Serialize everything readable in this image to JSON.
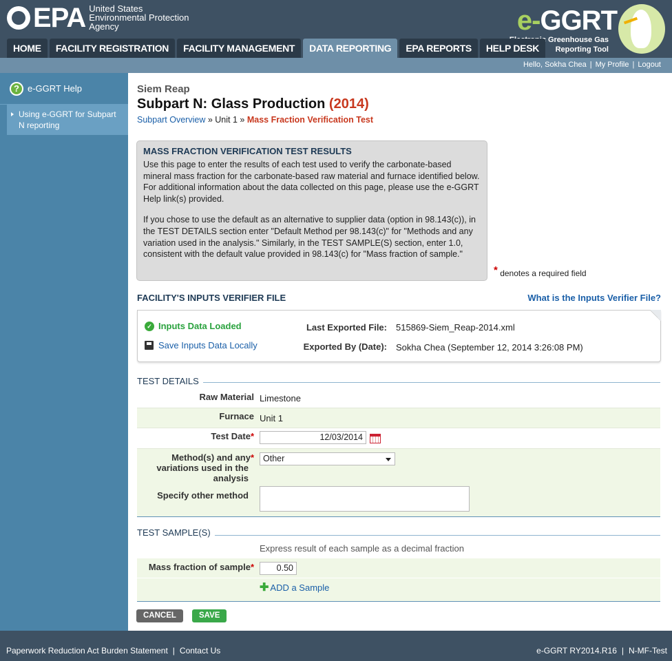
{
  "header": {
    "epa_word": "EPA",
    "epa_agency_lines": [
      "United States",
      "Environmental Protection",
      "Agency"
    ],
    "eggrt_title_e": "e-",
    "eggrt_title_rest": "GGRT",
    "eggrt_sub_lines": [
      "Electronic Greenhouse Gas",
      "Reporting Tool"
    ]
  },
  "nav": {
    "tabs": [
      {
        "label": "HOME",
        "active": false
      },
      {
        "label": "FACILITY REGISTRATION",
        "active": false
      },
      {
        "label": "FACILITY MANAGEMENT",
        "active": false
      },
      {
        "label": "DATA REPORTING",
        "active": true
      },
      {
        "label": "EPA REPORTS",
        "active": false
      },
      {
        "label": "HELP DESK",
        "active": false
      }
    ]
  },
  "userbar": {
    "greeting": "Hello, Sokha Chea",
    "profile": "My Profile",
    "logout": "Logout"
  },
  "sidebar": {
    "help_label": "e-GGRT Help",
    "link_label": "Using e-GGRT for Subpart N reporting"
  },
  "page": {
    "facility": "Siem Reap",
    "title": "Subpart N: Glass Production",
    "year": "(2014)",
    "breadcrumb": {
      "overview": "Subpart Overview",
      "sep": "»",
      "unit": "Unit 1",
      "current": "Mass Fraction Verification Test"
    }
  },
  "infobox": {
    "heading": "MASS FRACTION VERIFICATION TEST RESULTS",
    "para1": "Use this page to enter the results of each test used to verify the carbonate-based mineral mass fraction for the carbonate-based raw material and furnace identified below. For additional information about the data collected on this page, please use the e-GGRT Help link(s) provided.",
    "para2": "If you chose to use the default as an alternative to supplier data (option in 98.143(c)), in the TEST DETAILS section enter \"Default Method per 98.143(c)\" for \"Methods and any variation used in the analysis.\" Similarly, in the TEST SAMPLE(S) section, enter 1.0, consistent with the default value provided in 98.143(c) for \"Mass fraction of sample.\""
  },
  "required_note": {
    "star": "*",
    "text": "denotes a required field"
  },
  "verifier": {
    "section_title": "FACILITY'S INPUTS VERIFIER FILE",
    "help_link": "What is the Inputs Verifier File?",
    "loaded_text": "Inputs Data Loaded",
    "save_text": "Save Inputs Data Locally",
    "last_exported_label": "Last Exported File:",
    "last_exported_value": "515869-Siem_Reap-2014.xml",
    "exported_by_label": "Exported By (Date):",
    "exported_by_value": "Sokha Chea (September 12, 2014 3:26:08 PM)"
  },
  "test_details": {
    "heading": "TEST DETAILS",
    "raw_material_label": "Raw Material",
    "raw_material_value": "Limestone",
    "furnace_label": "Furnace",
    "furnace_value": "Unit 1",
    "test_date_label": "Test Date",
    "test_date_value": "12/03/2014",
    "method_label_lines": [
      "Method(s) and any",
      "variations used in the",
      "analysis"
    ],
    "method_value": "Other",
    "specify_label": "Specify other method",
    "specify_value": ""
  },
  "test_samples": {
    "heading": "TEST SAMPLE(S)",
    "hint": "Express result of each sample as a decimal fraction",
    "mass_fraction_label": "Mass fraction of sample",
    "mass_fraction_value": "0.50",
    "add_label": "ADD a Sample"
  },
  "buttons": {
    "cancel": "CANCEL",
    "save": "SAVE"
  },
  "footer": {
    "paperwork": "Paperwork Reduction Act Burden Statement",
    "contact": "Contact Us",
    "version": "e-GGRT RY2014.R16",
    "page_id": "N-MF-Test"
  }
}
